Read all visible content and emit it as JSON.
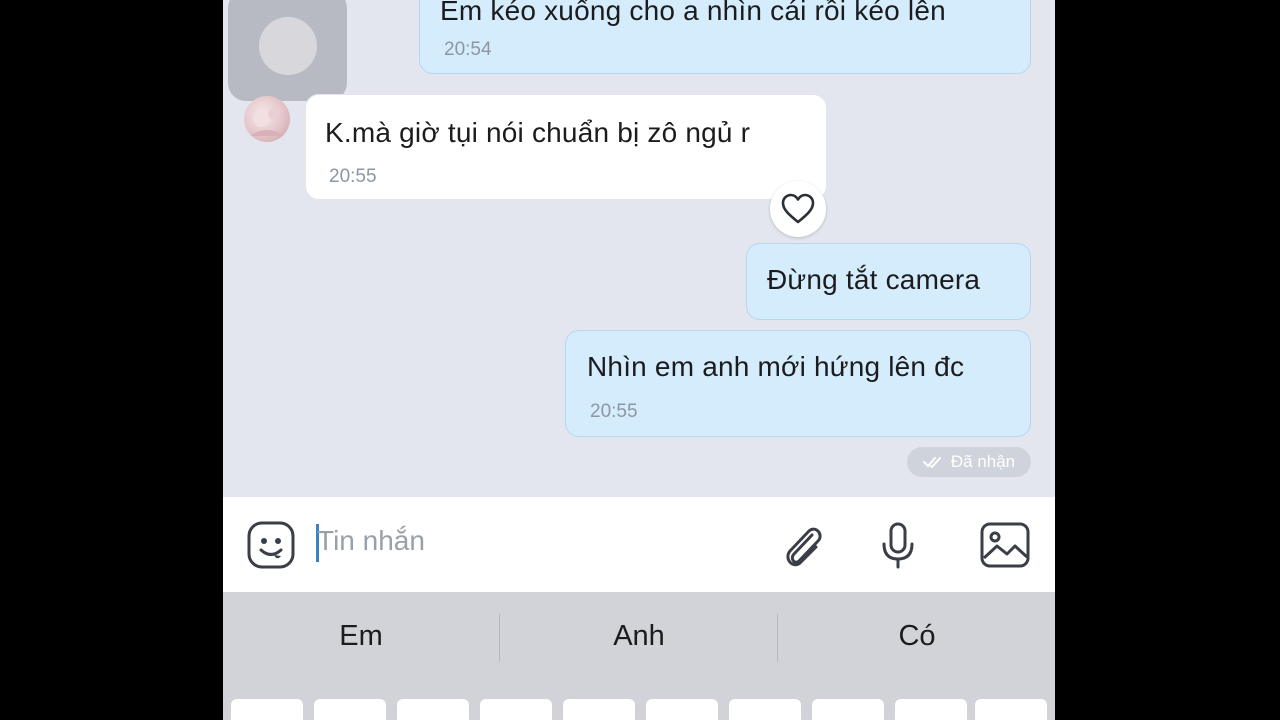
{
  "messages": [
    {
      "direction": "out",
      "text": "Em kéo xuống cho a nhìn cái rồi kéo lên",
      "time": "20:54"
    },
    {
      "direction": "in",
      "text": "K.mà giờ tụi nói chuẩn bị zô ngủ r",
      "time": "20:55"
    },
    {
      "direction": "out",
      "text": "Đừng tắt camera",
      "time": ""
    },
    {
      "direction": "out",
      "text": "Nhìn em anh mới hứng lên đc",
      "time": "20:55"
    }
  ],
  "status": {
    "label": "Đã nhận"
  },
  "input": {
    "placeholder": "Tin nhắn"
  },
  "keyboard": {
    "suggestions": [
      "Em",
      "Anh",
      "Có"
    ]
  },
  "icons": {
    "emoji": "emoji-icon",
    "attach": "paperclip-icon",
    "mic": "microphone-icon",
    "image": "image-icon",
    "heart": "heart-icon",
    "check": "double-check-icon"
  },
  "colors": {
    "outgoing_bubble": "#d4ecfb",
    "incoming_bubble": "#ffffff",
    "caret": "#3b82c4"
  }
}
